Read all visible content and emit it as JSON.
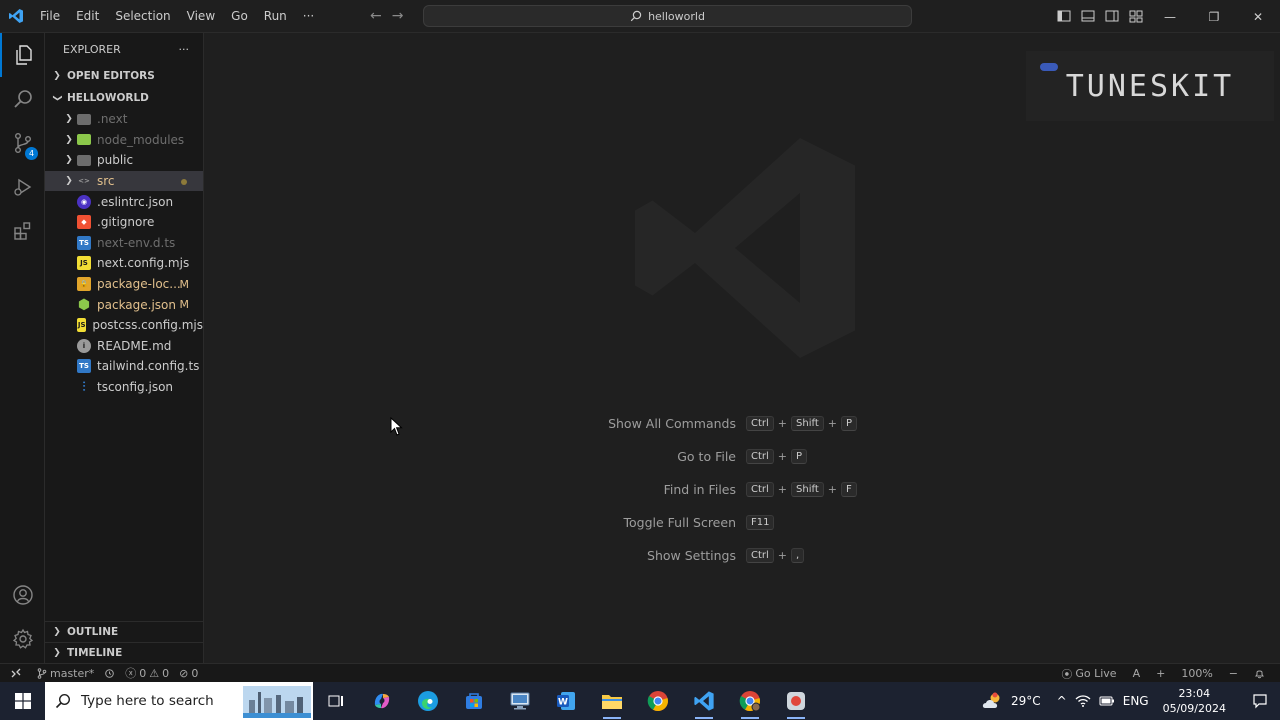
{
  "titlebar": {
    "menu": [
      "File",
      "Edit",
      "Selection",
      "View",
      "Go",
      "Run",
      "···"
    ],
    "search_text": "helloworld",
    "back_arrow": "←",
    "forward_arrow": "→",
    "controls": {
      "minimize": "—",
      "restore": "❐",
      "close": "✕"
    }
  },
  "activitybar": {
    "scm_badge": "4"
  },
  "sidebar": {
    "title": "EXPLORER",
    "more": "···",
    "open_editors": "OPEN EDITORS",
    "workspace": "HELLOWORLD",
    "items": [
      {
        "name": ".next",
        "type": "folder",
        "color": "#6e6e6e",
        "mod": ""
      },
      {
        "name": "node_modules",
        "type": "folder-node",
        "color": "#6e6e6e",
        "mod": ""
      },
      {
        "name": "public",
        "type": "folder",
        "color": "#cccccc",
        "mod": ""
      },
      {
        "name": "src",
        "type": "folder-src",
        "color": "#e2c08d",
        "mod": "dot"
      },
      {
        "name": ".eslintrc.json",
        "type": "eslint",
        "color": "#cccccc",
        "mod": ""
      },
      {
        "name": ".gitignore",
        "type": "git",
        "color": "#cccccc",
        "mod": ""
      },
      {
        "name": "next-env.d.ts",
        "type": "ts",
        "color": "#6e6e6e",
        "mod": ""
      },
      {
        "name": "next.config.mjs",
        "type": "js",
        "color": "#cccccc",
        "mod": ""
      },
      {
        "name": "package-loc...",
        "type": "lock",
        "color": "#e2c08d",
        "mod": "M"
      },
      {
        "name": "package.json",
        "type": "node",
        "color": "#e2c08d",
        "mod": "M"
      },
      {
        "name": "postcss.config.mjs",
        "type": "js",
        "color": "#cccccc",
        "mod": ""
      },
      {
        "name": "README.md",
        "type": "info",
        "color": "#cccccc",
        "mod": ""
      },
      {
        "name": "tailwind.config.ts",
        "type": "ts",
        "color": "#cccccc",
        "mod": ""
      },
      {
        "name": "tsconfig.json",
        "type": "tsconfig",
        "color": "#cccccc",
        "mod": ""
      }
    ],
    "outline": "OUTLINE",
    "timeline": "TIMELINE"
  },
  "editor": {
    "brand": "TUNESKIT",
    "shortcuts": [
      {
        "label": "Show All Commands",
        "keys": [
          "Ctrl",
          "Shift",
          "P"
        ]
      },
      {
        "label": "Go to File",
        "keys": [
          "Ctrl",
          "P"
        ]
      },
      {
        "label": "Find in Files",
        "keys": [
          "Ctrl",
          "Shift",
          "F"
        ]
      },
      {
        "label": "Toggle Full Screen",
        "keys": [
          "F11"
        ]
      },
      {
        "label": "Show Settings",
        "keys": [
          "Ctrl",
          ","
        ]
      }
    ]
  },
  "statusbar": {
    "branch": "master*",
    "errors": "0",
    "warnings": "0",
    "ports": "0",
    "go_live": "Go Live",
    "zoom": "100%",
    "font_size_label": "A",
    "zoom_in": "+",
    "zoom_out": "−"
  },
  "taskbar": {
    "search_placeholder": "Type here to search",
    "weather": "29°C",
    "language": "ENG",
    "time": "23:04",
    "date": "05/09/2024"
  }
}
